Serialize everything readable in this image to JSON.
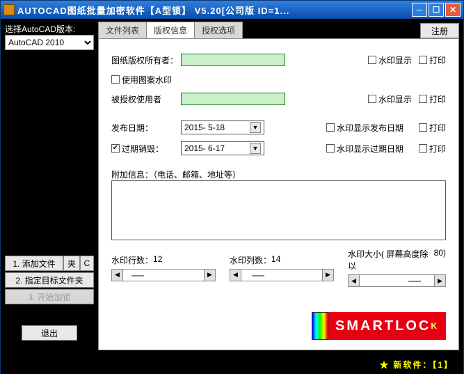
{
  "titlebar": {
    "text": "AUTOCAD图纸批量加密软件【A型锁】 V5.20[公司版 ID=1..."
  },
  "left": {
    "select_label": "选择AutoCAD版本:",
    "select_value": "AutoCAD 2010",
    "btn_add_files": "1. 添加文件",
    "btn_folder": "夹",
    "btn_c": "C",
    "btn_target_folder": "2. 指定目标文件夹",
    "btn_start_lock": "3. 开始加锁",
    "btn_exit": "退出"
  },
  "tabs": {
    "t1": "文件列表",
    "t2": "版权信息",
    "t3": "授权选项",
    "register": "注册"
  },
  "form": {
    "owner_label": "图纸版权所有者：",
    "use_pattern_wm": "使用图案水印",
    "licensed_user": "被授权使用者",
    "wm_show": "水印显示",
    "print": "打印",
    "publish_date_label": "发布日期：",
    "publish_date": "2015- 5-18",
    "wm_show_pub": "水印显示发布日期",
    "expire_destroy": "过期销毁：",
    "expire_date": "2015- 6-17",
    "wm_show_exp": "水印显示过期日期",
    "addinfo_label": "附加信息：（电话、邮箱、地址等）",
    "wm_rows_label": "水印行数：",
    "wm_rows_val": "12",
    "wm_cols_label": "水印列数：",
    "wm_cols_val": "14",
    "wm_size_label": "水印大小( 屏幕高度除以 ",
    "wm_size_val": "80",
    "wm_size_tail": " )"
  },
  "logo_text": "SMARTLOCK",
  "status": {
    "text": "★ 新软件：【1】"
  }
}
